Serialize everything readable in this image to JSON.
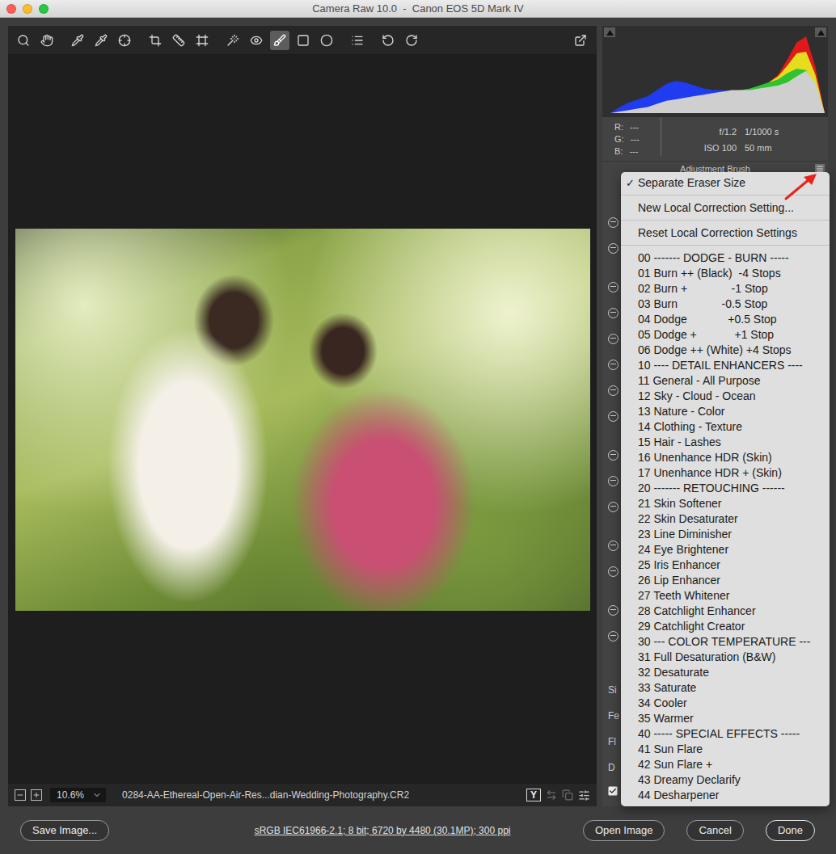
{
  "window": {
    "title": "Camera Raw 10.0  -  Canon EOS 5D Mark IV"
  },
  "toolbar": {
    "tools": [
      {
        "selected": false
      },
      {
        "selected": false
      },
      {
        "selected": false
      },
      {
        "selected": false
      },
      {
        "selected": false
      },
      {
        "selected": false
      },
      {
        "selected": false
      },
      {
        "selected": false
      },
      {
        "selected": false
      },
      {
        "selected": false
      },
      {
        "selected": true
      },
      {
        "selected": false
      },
      {
        "selected": false
      },
      {
        "selected": false
      },
      {
        "selected": false
      },
      {
        "selected": false
      }
    ]
  },
  "histogram": {
    "series": [
      {
        "color": "#e01a1a",
        "values": [
          0,
          2,
          4,
          6,
          8,
          10,
          12,
          14,
          16,
          18,
          20,
          22,
          24,
          26,
          28,
          30,
          34,
          40,
          50,
          70,
          92,
          100,
          60,
          0
        ]
      },
      {
        "color": "#e6dc1e",
        "values": [
          0,
          2,
          4,
          6,
          8,
          10,
          12,
          14,
          16,
          18,
          20,
          22,
          24,
          26,
          28,
          30,
          34,
          40,
          48,
          62,
          78,
          80,
          50,
          0
        ]
      },
      {
        "color": "#2fc42f",
        "values": [
          0,
          3,
          6,
          8,
          10,
          12,
          14,
          16,
          18,
          20,
          22,
          24,
          26,
          28,
          30,
          32,
          36,
          40,
          44,
          52,
          58,
          56,
          36,
          0
        ]
      },
      {
        "color": "#1f3cf0",
        "values": [
          0,
          8,
          14,
          18,
          22,
          30,
          38,
          42,
          40,
          36,
          32,
          30,
          30,
          28,
          25,
          22,
          18,
          15,
          12,
          10,
          8,
          5,
          2,
          0
        ]
      },
      {
        "color": "#cfcfcf",
        "values": [
          0,
          2,
          4,
          6,
          8,
          12,
          16,
          18,
          20,
          22,
          24,
          26,
          28,
          30,
          30,
          30,
          32,
          34,
          36,
          40,
          48,
          55,
          40,
          0
        ]
      }
    ]
  },
  "readout": {
    "rgb": [
      {
        "label": "R:",
        "value": "---"
      },
      {
        "label": "G:",
        "value": "---"
      },
      {
        "label": "B:",
        "value": "---"
      }
    ],
    "exif": {
      "aperture": "f/1.2",
      "shutter": "1/1000 s",
      "iso": "ISO 100",
      "focal_length": "50 mm"
    }
  },
  "panel": {
    "title": "Adjustment Brush",
    "brush_labels": [
      "Si",
      "Fe",
      "Fl",
      "D"
    ],
    "auto_mask": {
      "checked": true
    }
  },
  "menu": {
    "mark": "✓",
    "items": [
      {
        "kind": "item",
        "label": "Separate Eraser Size",
        "checked": true
      },
      {
        "kind": "separator"
      },
      {
        "kind": "item",
        "label": "New Local Correction Setting...",
        "checked": false
      },
      {
        "kind": "separator"
      },
      {
        "kind": "item",
        "label": "Reset Local Correction Settings",
        "checked": false
      },
      {
        "kind": "separator"
      },
      {
        "kind": "item",
        "label": "00 ------- DODGE - BURN -----",
        "checked": false
      },
      {
        "kind": "item",
        "label": "01 Burn ++ (Black)  -4 Stops",
        "checked": false
      },
      {
        "kind": "item",
        "label": "02 Burn +              -1 Stop",
        "checked": false
      },
      {
        "kind": "item",
        "label": "03 Burn              -0.5 Stop",
        "checked": false
      },
      {
        "kind": "item",
        "label": "04 Dodge             +0.5 Stop",
        "checked": false
      },
      {
        "kind": "item",
        "label": "05 Dodge +            +1 Stop",
        "checked": false
      },
      {
        "kind": "item",
        "label": "06 Dodge ++ (White) +4 Stops",
        "checked": false
      },
      {
        "kind": "item",
        "label": "10 ---- DETAIL ENHANCERS ----",
        "checked": false
      },
      {
        "kind": "item",
        "label": "11 General - All Purpose",
        "checked": false
      },
      {
        "kind": "item",
        "label": "12 Sky - Cloud - Ocean",
        "checked": false
      },
      {
        "kind": "item",
        "label": "13 Nature - Color",
        "checked": false
      },
      {
        "kind": "item",
        "label": "14 Clothing - Texture",
        "checked": false
      },
      {
        "kind": "item",
        "label": "15 Hair - Lashes",
        "checked": false
      },
      {
        "kind": "item",
        "label": "16 Unenhance HDR (Skin)",
        "checked": false
      },
      {
        "kind": "item",
        "label": "17 Unenhance HDR + (Skin)",
        "checked": false
      },
      {
        "kind": "item",
        "label": "20 ------- RETOUCHING ------",
        "checked": false
      },
      {
        "kind": "item",
        "label": "21 Skin Softener",
        "checked": false
      },
      {
        "kind": "item",
        "label": "22 Skin Desaturater",
        "checked": false
      },
      {
        "kind": "item",
        "label": "23 Line Diminisher",
        "checked": false
      },
      {
        "kind": "item",
        "label": "24 Eye Brightener",
        "checked": false
      },
      {
        "kind": "item",
        "label": "25 Iris Enhancer",
        "checked": false
      },
      {
        "kind": "item",
        "label": "26 Lip Enhancer",
        "checked": false
      },
      {
        "kind": "item",
        "label": "27 Teeth Whitener",
        "checked": false
      },
      {
        "kind": "item",
        "label": "28 Catchlight Enhancer",
        "checked": false
      },
      {
        "kind": "item",
        "label": "29 Catchlight Creator",
        "checked": false
      },
      {
        "kind": "item",
        "label": "30 --- COLOR TEMPERATURE ---",
        "checked": false
      },
      {
        "kind": "item",
        "label": "31 Full Desaturation (B&W)",
        "checked": false
      },
      {
        "kind": "item",
        "label": "32 Desaturate",
        "checked": false
      },
      {
        "kind": "item",
        "label": "33 Saturate",
        "checked": false
      },
      {
        "kind": "item",
        "label": "34 Cooler",
        "checked": false
      },
      {
        "kind": "item",
        "label": "35 Warmer",
        "checked": false
      },
      {
        "kind": "item",
        "label": "40 ----- SPECIAL EFFECTS -----",
        "checked": false
      },
      {
        "kind": "item",
        "label": "41 Sun Flare",
        "checked": false
      },
      {
        "kind": "item",
        "label": "42 Sun Flare +",
        "checked": false
      },
      {
        "kind": "item",
        "label": "43 Dreamy Declarify",
        "checked": false
      },
      {
        "kind": "item",
        "label": "44 Desharpener",
        "checked": false
      }
    ]
  },
  "status_bar": {
    "zoom": "10.6%",
    "filename": "0284-AA-Ethereal-Open-Air-Res...dian-Wedding-Photography.CR2",
    "view_toggle": "Y"
  },
  "bottom_bar": {
    "save": "Save Image...",
    "workflow": "sRGB IEC61966-2.1; 8 bit; 6720 by 4480 (30.1MP); 300 ppi",
    "buttons": [
      {
        "label": "Open Image",
        "primary": false
      },
      {
        "label": "Cancel",
        "primary": false
      },
      {
        "label": "Done",
        "primary": true
      }
    ]
  }
}
